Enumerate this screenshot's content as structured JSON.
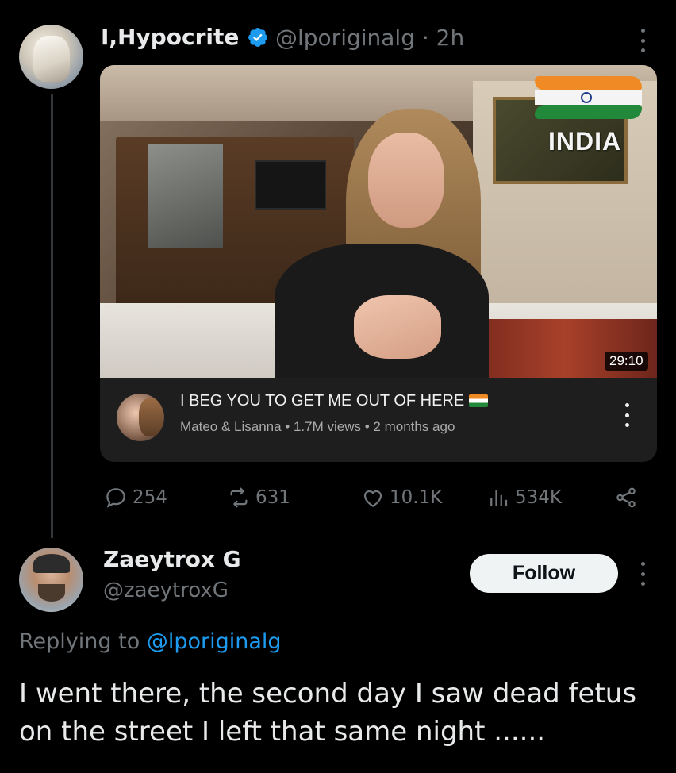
{
  "tweet": {
    "author_name": "I,Hypocrite",
    "author_handle": "@lporiginalg",
    "time": "2h",
    "handle_time": "@lporiginalg · 2h",
    "video_card": {
      "overlay_text": "INDIA",
      "duration": "29:10",
      "title": "I BEG YOU TO GET ME OUT OF HERE",
      "channel": "Mateo & Lisanna",
      "views": "1.7M views",
      "age": "2 months ago",
      "meta_line": "Mateo & Lisanna • 1.7M views • 2 months ago"
    },
    "actions": {
      "replies": "254",
      "retweets": "631",
      "likes": "10.1K",
      "views": "534K"
    }
  },
  "reply": {
    "author_name": "Zaeytrox G",
    "author_handle": "@zaeytroxG",
    "follow_label": "Follow",
    "replying_to_prefix": "Replying to",
    "replying_to_handle": "@lporiginalg",
    "text": "I went there, the second day I saw dead fetus on the street I left that same night ......"
  },
  "icons": {
    "verified": "verified-badge-icon",
    "reply": "reply-icon",
    "retweet": "retweet-icon",
    "like": "heart-icon",
    "views": "views-icon",
    "share": "share-icon",
    "more": "more-icon"
  },
  "colors": {
    "background": "#000000",
    "text_primary": "#e7e9ea",
    "text_secondary": "#71767b",
    "link": "#1d9bf0",
    "verified": "#1d9bf0",
    "follow_bg": "#eff3f4"
  }
}
